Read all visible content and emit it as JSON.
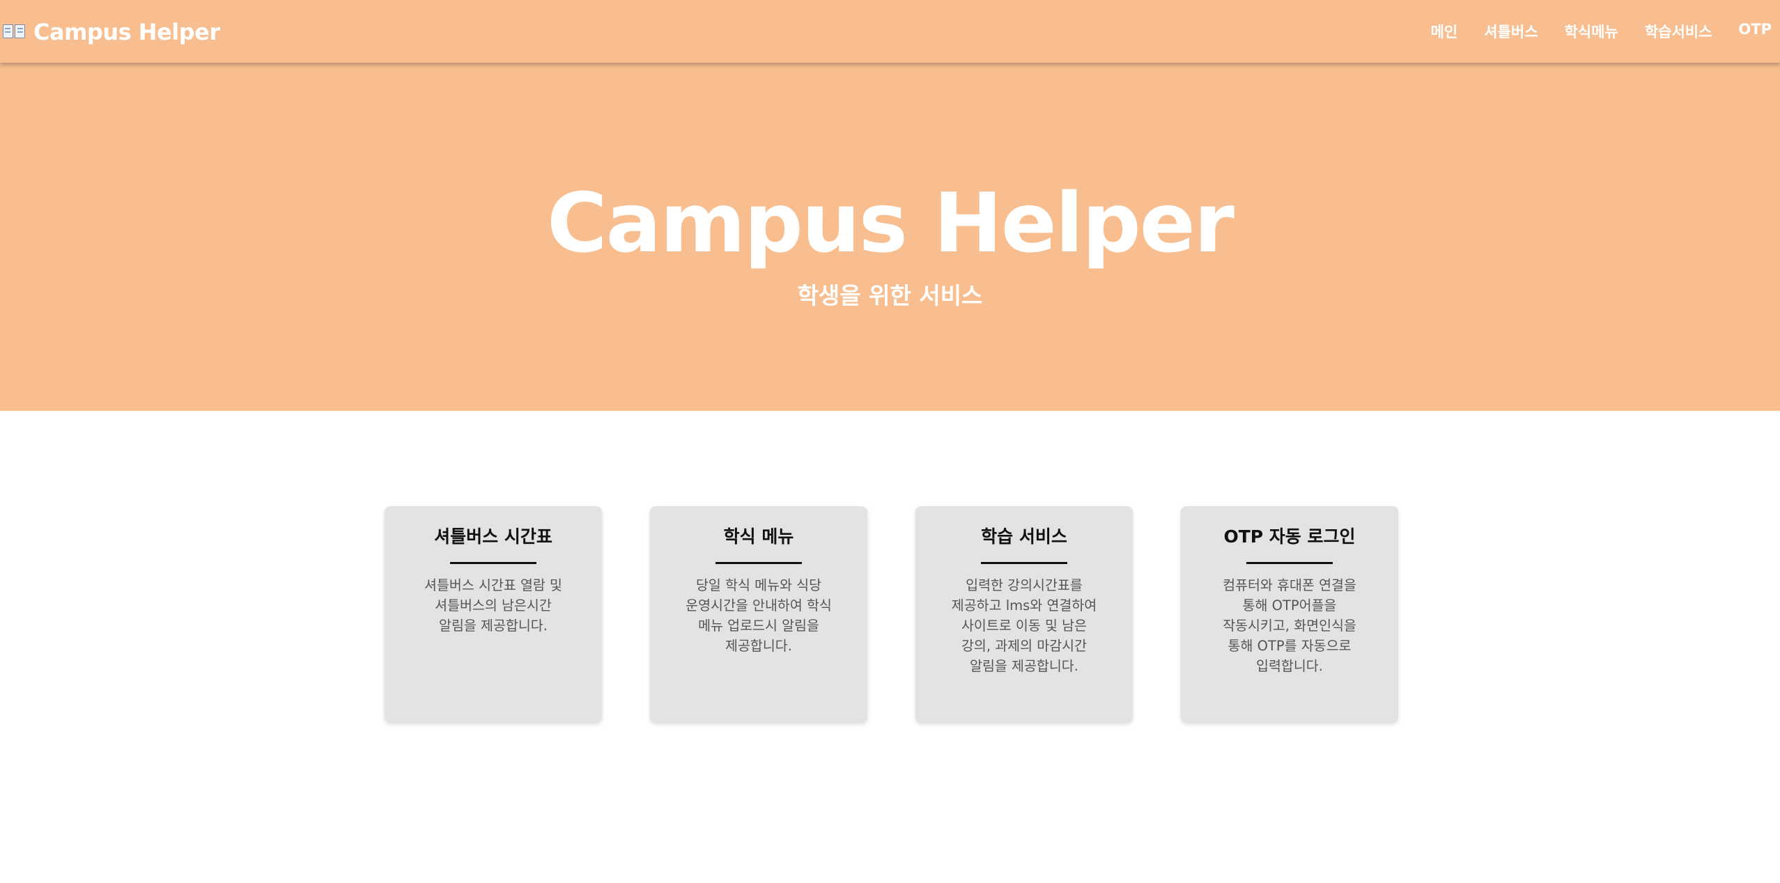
{
  "navbar": {
    "brand": "Campus Helper",
    "brand_icon": "open-book-icon",
    "links": [
      "메인",
      "셔틀버스",
      "학식메뉴",
      "학습서비스",
      "OTP"
    ]
  },
  "hero": {
    "title": "Campus Helper",
    "subtitle": "학생을 위한 서비스"
  },
  "cards": [
    {
      "title": "셔틀버스 시간표",
      "description": "셔틀버스 시간표 열람 및 셔틀버스의 남은시간 알림을 제공합니다."
    },
    {
      "title": "학식 메뉴",
      "description": "당일 학식 메뉴와 식당 운영시간을 안내하여 학식 메뉴 업로드시 알림을 제공합니다."
    },
    {
      "title": "학습 서비스",
      "description": "입력한 강의시간표를 제공하고 lms와 연결하여 사이트로 이동 및 남은 강의, 과제의 마감시간 알림을 제공합니다."
    },
    {
      "title": "OTP 자동 로그인",
      "description": "컴퓨터와 휴대폰 연결을 통해 OTP어플을 작동시키고, 화면인식을 통해 OTP를 자동으로 입력합니다."
    }
  ],
  "colors": {
    "primary": "#f8be8f",
    "card_bg": "#e3e3e3",
    "text_dark": "#111111",
    "text_muted": "#555555"
  }
}
